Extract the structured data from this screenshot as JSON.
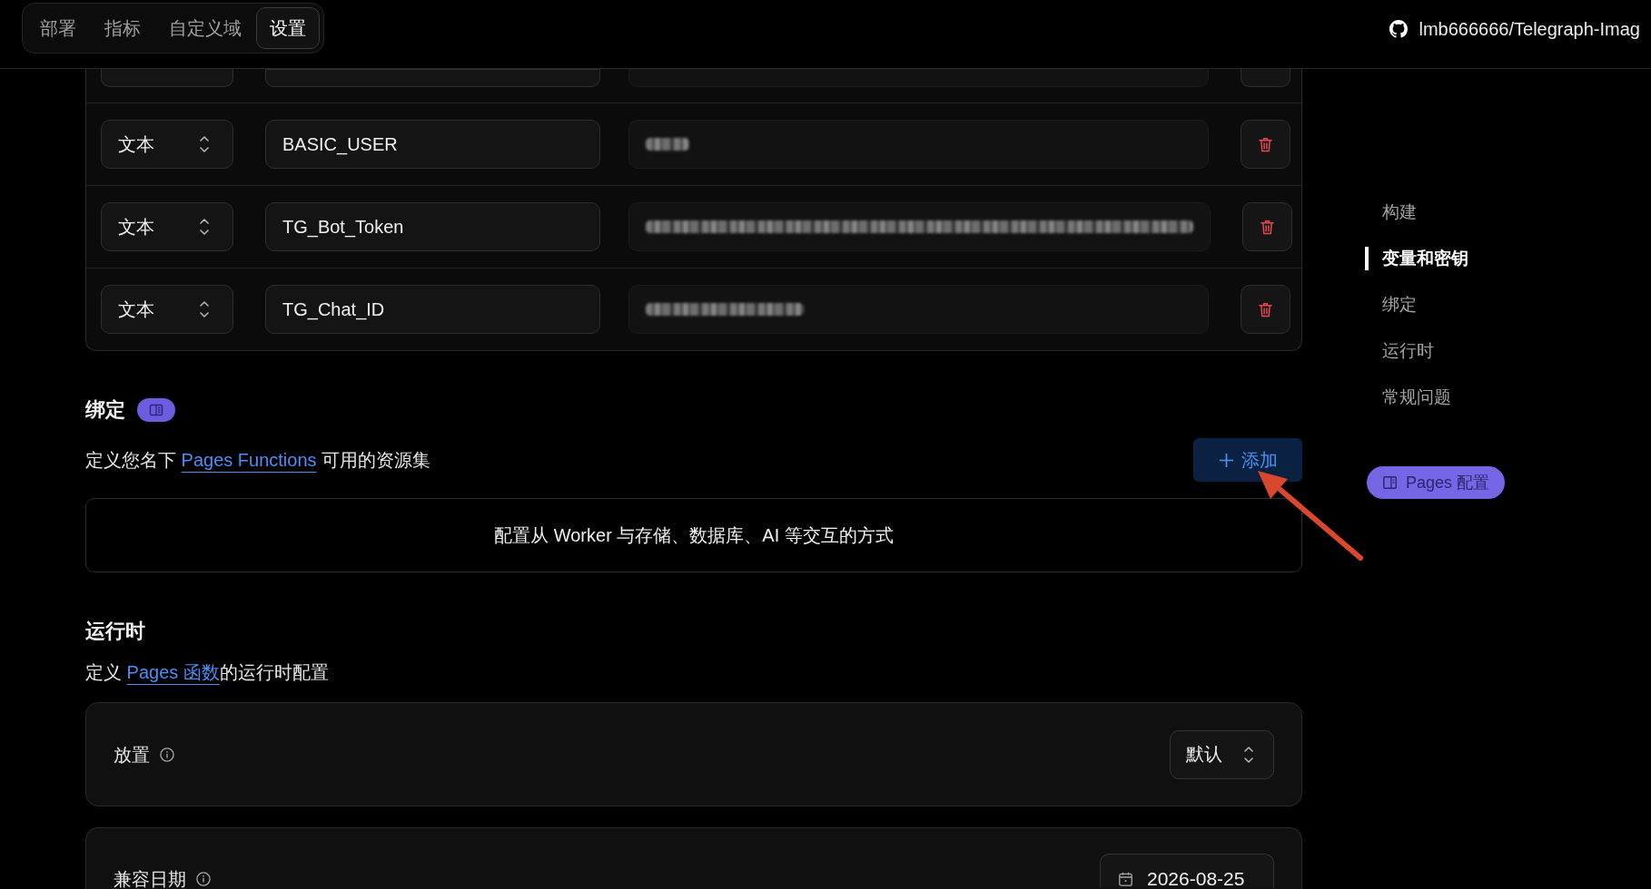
{
  "top_tabs": [
    {
      "label": "部署",
      "selected": false
    },
    {
      "label": "指标",
      "selected": false
    },
    {
      "label": "自定义域",
      "selected": false
    },
    {
      "label": "设置",
      "selected": true
    }
  ],
  "repo_link": {
    "label": "lmb666666/Telegraph-Imag"
  },
  "variables": {
    "rows": [
      {
        "kind": "cut"
      },
      {
        "kind": "short",
        "type": "文本",
        "name": "BASIC_USER"
      },
      {
        "kind": "long",
        "type": "文本",
        "name": "TG_Bot_Token"
      },
      {
        "kind": "medium",
        "type": "文本",
        "name": "TG_Chat_ID"
      }
    ]
  },
  "bindings": {
    "title": "绑定",
    "description": {
      "before": "定义您名下 ",
      "link": "Pages Functions",
      "after": " 可用的资源集"
    },
    "add_button": {
      "label": "添加"
    },
    "empty_message": "配置从 Worker 与存储、数据库、AI 等交互的方式"
  },
  "runtime": {
    "title": "运行时",
    "description": {
      "before": "定义 ",
      "link": "Pages 函数",
      "after": "的运行时配置"
    },
    "settings": [
      {
        "kind": "select",
        "label": "放置",
        "value": "默认"
      },
      {
        "kind": "date",
        "label": "兼容日期",
        "value": "2026-08-25"
      }
    ]
  },
  "nav": {
    "items": [
      {
        "label": "构建",
        "selected": false
      },
      {
        "label": "变量和密钥",
        "selected": true
      },
      {
        "label": "绑定",
        "selected": false
      },
      {
        "label": "运行时",
        "selected": false
      },
      {
        "label": "常规问题",
        "selected": false
      }
    ],
    "config_button": {
      "label": "Pages 配置"
    }
  },
  "annotations": [
    {
      "kind": "arrow"
    }
  ]
}
